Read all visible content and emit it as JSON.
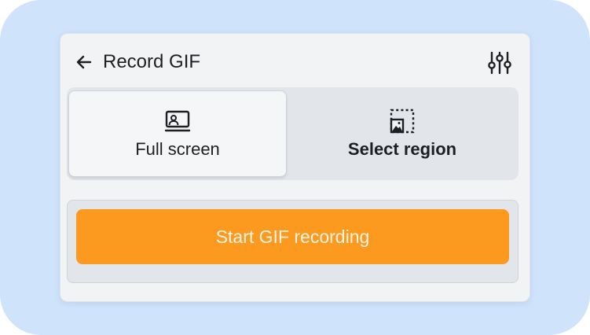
{
  "header": {
    "back_icon": "arrow-left-icon",
    "title": "Record GIF",
    "settings_icon": "sliders-icon"
  },
  "capture_mode": {
    "selected": "Full screen",
    "options": [
      {
        "label": "Full screen",
        "icon": "screen-user-icon"
      },
      {
        "label": "Select region",
        "icon": "region-select-icon"
      }
    ]
  },
  "record": {
    "button_label": "Start GIF recording"
  },
  "colors": {
    "accent": "#fb9a1e",
    "backdrop": "#cfe3fb",
    "panel": "#f2f3f5"
  }
}
